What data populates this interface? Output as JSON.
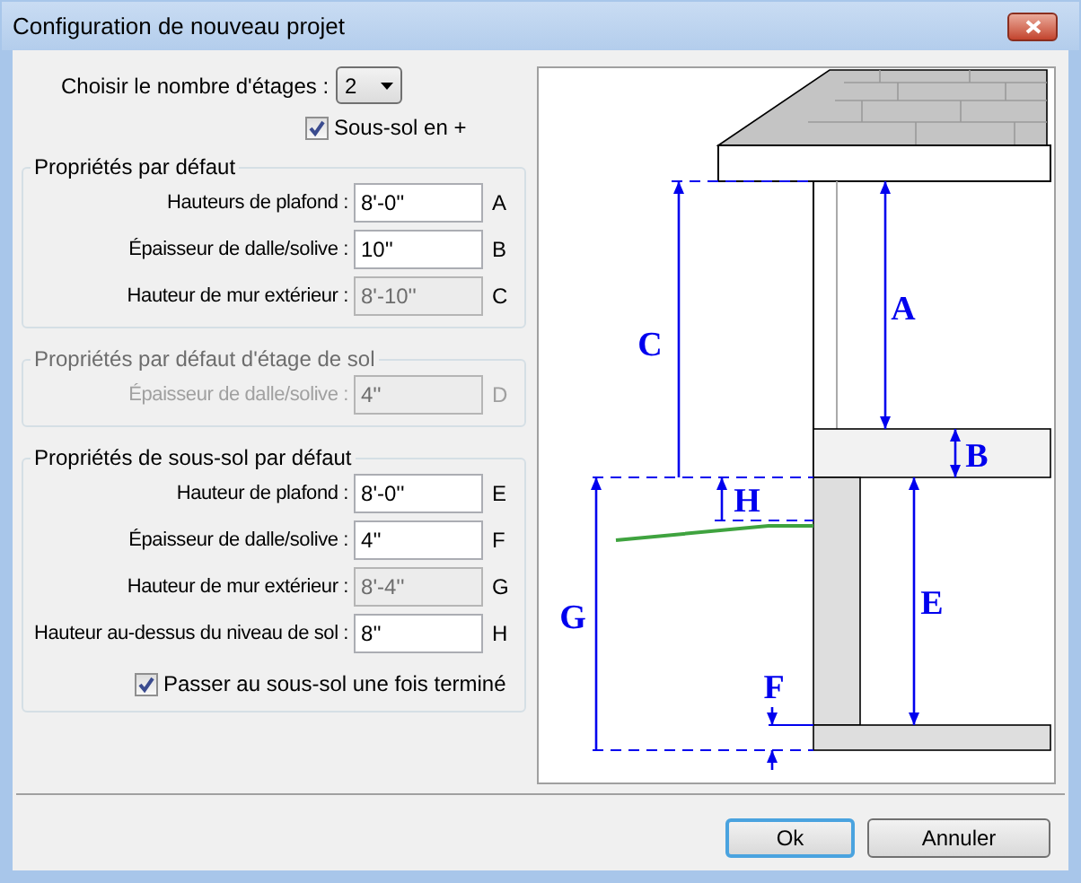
{
  "window": {
    "title": "Configuration de nouveau projet"
  },
  "floors": {
    "label": "Choisir le nombre d'étages :",
    "value": "2"
  },
  "basement_option": {
    "label": "Sous-sol en +",
    "checked": true
  },
  "groups": [
    {
      "title": "Propriétés par défaut",
      "disabled": false,
      "fields": [
        {
          "label": "Hauteurs de plafond :",
          "value": "8'-0''",
          "read_only": false,
          "letter": "A"
        },
        {
          "label": "Épaisseur de dalle/solive :",
          "value": "10''",
          "read_only": false,
          "letter": "B"
        },
        {
          "label": "Hauteur de mur extérieur :",
          "value": "8'-10''",
          "read_only": true,
          "letter": "C"
        }
      ]
    },
    {
      "title": "Propriétés par défaut d'étage de sol",
      "disabled": true,
      "fields": [
        {
          "label": "Épaisseur de dalle/solive :",
          "value": "4''",
          "read_only": true,
          "letter": "D"
        }
      ]
    },
    {
      "title": "Propriétés de sous-sol par défaut",
      "disabled": false,
      "fields": [
        {
          "label": "Hauteur de plafond :",
          "value": "8'-0''",
          "read_only": false,
          "letter": "E"
        },
        {
          "label": "Épaisseur de dalle/solive :",
          "value": "4''",
          "read_only": false,
          "letter": "F"
        },
        {
          "label": "Hauteur de mur extérieur :",
          "value": "8'-4''",
          "read_only": true,
          "letter": "G"
        },
        {
          "label": "Hauteur au-dessus du niveau de sol :",
          "value": "8''",
          "read_only": false,
          "letter": "H"
        }
      ],
      "checkbox": {
        "label": "Passer au sous-sol une fois terminé",
        "checked": true
      }
    }
  ],
  "diagram": {
    "labels": [
      "A",
      "B",
      "C",
      "E",
      "F",
      "G",
      "H"
    ]
  },
  "buttons": [
    {
      "label": "Ok",
      "default": true
    },
    {
      "label": "Annuler",
      "default": false
    }
  ]
}
